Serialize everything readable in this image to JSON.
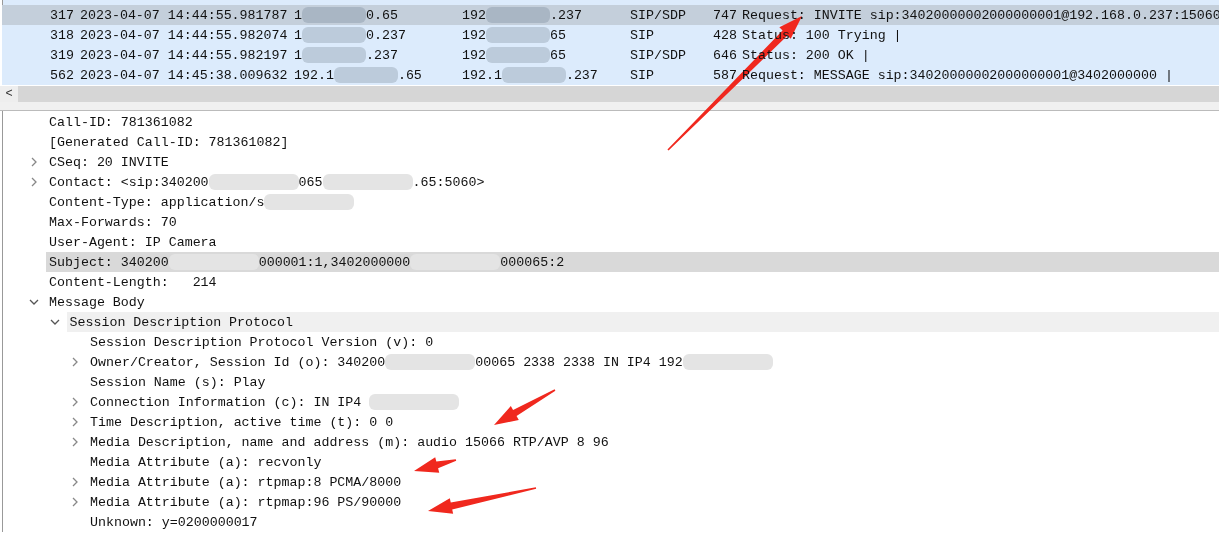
{
  "packet_list": {
    "rows": [
      {
        "no": "317",
        "time": "2023-04-07 14:44:55.981787",
        "source": {
          "before": "1",
          "after": "0.65"
        },
        "destination": {
          "before": "192",
          "after": ".237"
        },
        "protocol": "SIP/SDP",
        "length": "747",
        "info": "Request: INVITE sip:34020000002000000001@192.168.0.237:15060",
        "selected": true
      },
      {
        "no": "318",
        "time": "2023-04-07 14:44:55.982074",
        "source": {
          "before": "1",
          "after": "0.237"
        },
        "destination": {
          "before": "192",
          "after": "65"
        },
        "protocol": "SIP",
        "length": "428",
        "info": "Status: 100 Trying |",
        "selected": false
      },
      {
        "no": "319",
        "time": "2023-04-07 14:44:55.982197",
        "source": {
          "before": "1",
          "after": ".237"
        },
        "destination": {
          "before": "192",
          "after": "65"
        },
        "protocol": "SIP/SDP",
        "length": "646",
        "info": "Status: 200 OK |",
        "selected": false
      },
      {
        "no": "562",
        "time": "2023-04-07 14:45:38.009632",
        "source": {
          "before": "192.1",
          "after": ".65"
        },
        "destination": {
          "before": "192.1",
          "after": ".237"
        },
        "protocol": "SIP",
        "length": "587",
        "info": "Request: MESSAGE sip:34020000002000000001@3402000000 |",
        "selected": false
      }
    ],
    "scroll_left": "<"
  },
  "details": {
    "tree": [
      {
        "children": [
          {
            "text": "Call-ID: 781361082",
            "selected": false
          },
          {
            "text": "[Generated Call-ID: 781361082]",
            "selected": false
          },
          {
            "text": "CSeq: 20 INVITE",
            "expanded": false,
            "selected": false
          },
          {
            "parts": [
              {
                "text": "Contact: <sip:340200"
              },
              {
                "kind": "blur"
              },
              {
                "text": "065"
              },
              {
                "kind": "blur"
              },
              {
                "text": ".65:5060>"
              }
            ],
            "expanded": false,
            "selected": false
          },
          {
            "parts": [
              {
                "text": "Content-Type: application/s"
              },
              {
                "kind": "blur"
              }
            ],
            "selected": false
          },
          {
            "text": "Max-Forwards: 70",
            "selected": false
          },
          {
            "text": "User-Agent: IP Camera",
            "selected": false
          },
          {
            "parts": [
              {
                "text": "Subject: 340200"
              },
              {
                "kind": "blur"
              },
              {
                "text": "000001:1,3402000000"
              },
              {
                "kind": "blur"
              },
              {
                "text": "000065:2"
              }
            ],
            "selected": true
          },
          {
            "text": "Content-Length:   214",
            "selected": false
          }
        ]
      },
      {
        "text": "Message Body",
        "expanded": true,
        "selected": false,
        "children": [
          {
            "text": "Session Description Protocol",
            "expanded": true,
            "selected": false,
            "hovered": true,
            "children": [
              {
                "text": "Session Description Protocol Version (v): 0",
                "selected": false
              },
              {
                "parts": [
                  {
                    "text": "Owner/Creator, Session Id (o): 340200"
                  },
                  {
                    "kind": "blur"
                  },
                  {
                    "text": "00065 2338 2338 IN IP4 192"
                  },
                  {
                    "kind": "blur"
                  }
                ],
                "expanded": false,
                "selected": false
              },
              {
                "text": "Session Name (s): Play",
                "selected": false
              },
              {
                "parts": [
                  {
                    "text": "Connection Information (c): IN IP4 "
                  },
                  {
                    "kind": "blur"
                  }
                ],
                "expanded": false,
                "selected": false
              },
              {
                "text": "Time Description, active time (t): 0 0",
                "expanded": false,
                "selected": false
              },
              {
                "text": "Media Description, name and address (m): audio 15066 RTP/AVP 8 96",
                "expanded": false,
                "selected": false
              },
              {
                "text": "Media Attribute (a): recvonly",
                "selected": false
              },
              {
                "text": "Media Attribute (a): rtpmap:8 PCMA/8000",
                "expanded": false,
                "selected": false
              },
              {
                "text": "Media Attribute (a): rtpmap:96 PS/90000",
                "expanded": false,
                "selected": false
              },
              {
                "text": "Unknown: y=0200000017",
                "selected": false
              }
            ]
          }
        ]
      }
    ]
  }
}
